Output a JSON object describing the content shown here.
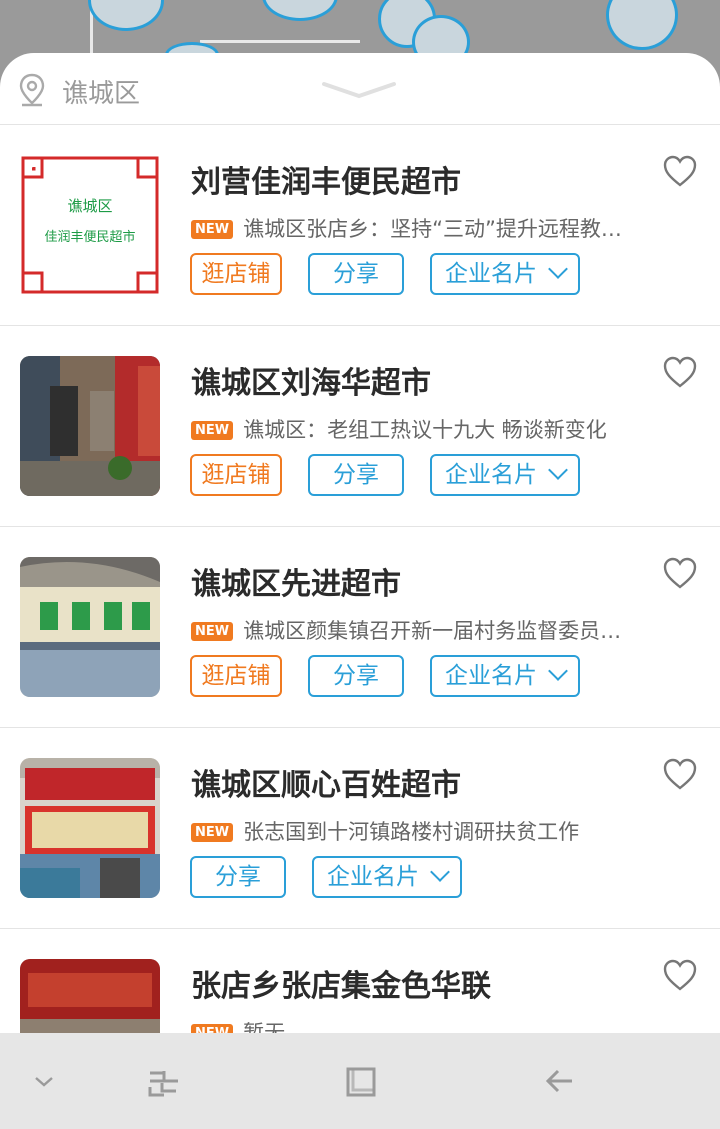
{
  "location": {
    "district": "谯城区"
  },
  "stores": [
    {
      "name": "刘营佳润丰便民超市",
      "news_tag": "NEW",
      "news": "谯城区张店乡：坚持“三动”提升远程教育实效",
      "buttons": [
        "逛店铺",
        "分享",
        "企业名片"
      ],
      "thumb_lines": [
        "谯城区",
        "佳润丰便民超市"
      ]
    },
    {
      "name": "谯城区刘海华超市",
      "news_tag": "NEW",
      "news": "谯城区：老组工热议十九大 畅谈新变化",
      "buttons": [
        "逛店铺",
        "分享",
        "企业名片"
      ]
    },
    {
      "name": "谯城区先进超市",
      "news_tag": "NEW",
      "news": "谯城区颜集镇召开新一届村务监督委员会会议",
      "buttons": [
        "逛店铺",
        "分享",
        "企业名片"
      ]
    },
    {
      "name": "谯城区顺心百姓超市",
      "news_tag": "NEW",
      "news": "张志国到十河镇路楼村调研扶贫工作",
      "buttons": [
        "分享",
        "企业名片"
      ]
    },
    {
      "name": "张店乡张店集金色华联",
      "news_tag": "NEW",
      "news": "暂无",
      "buttons": []
    }
  ],
  "colors": {
    "accent": "#2a9fd8",
    "orange": "#f07a20",
    "text": "#2b2b2b"
  },
  "icons": [
    "location-pin-icon",
    "collapse-chevron-icon",
    "heart-icon",
    "chevron-down-icon",
    "nav-down-icon",
    "recent-apps-icon",
    "home-square-icon",
    "back-arrow-icon"
  ]
}
